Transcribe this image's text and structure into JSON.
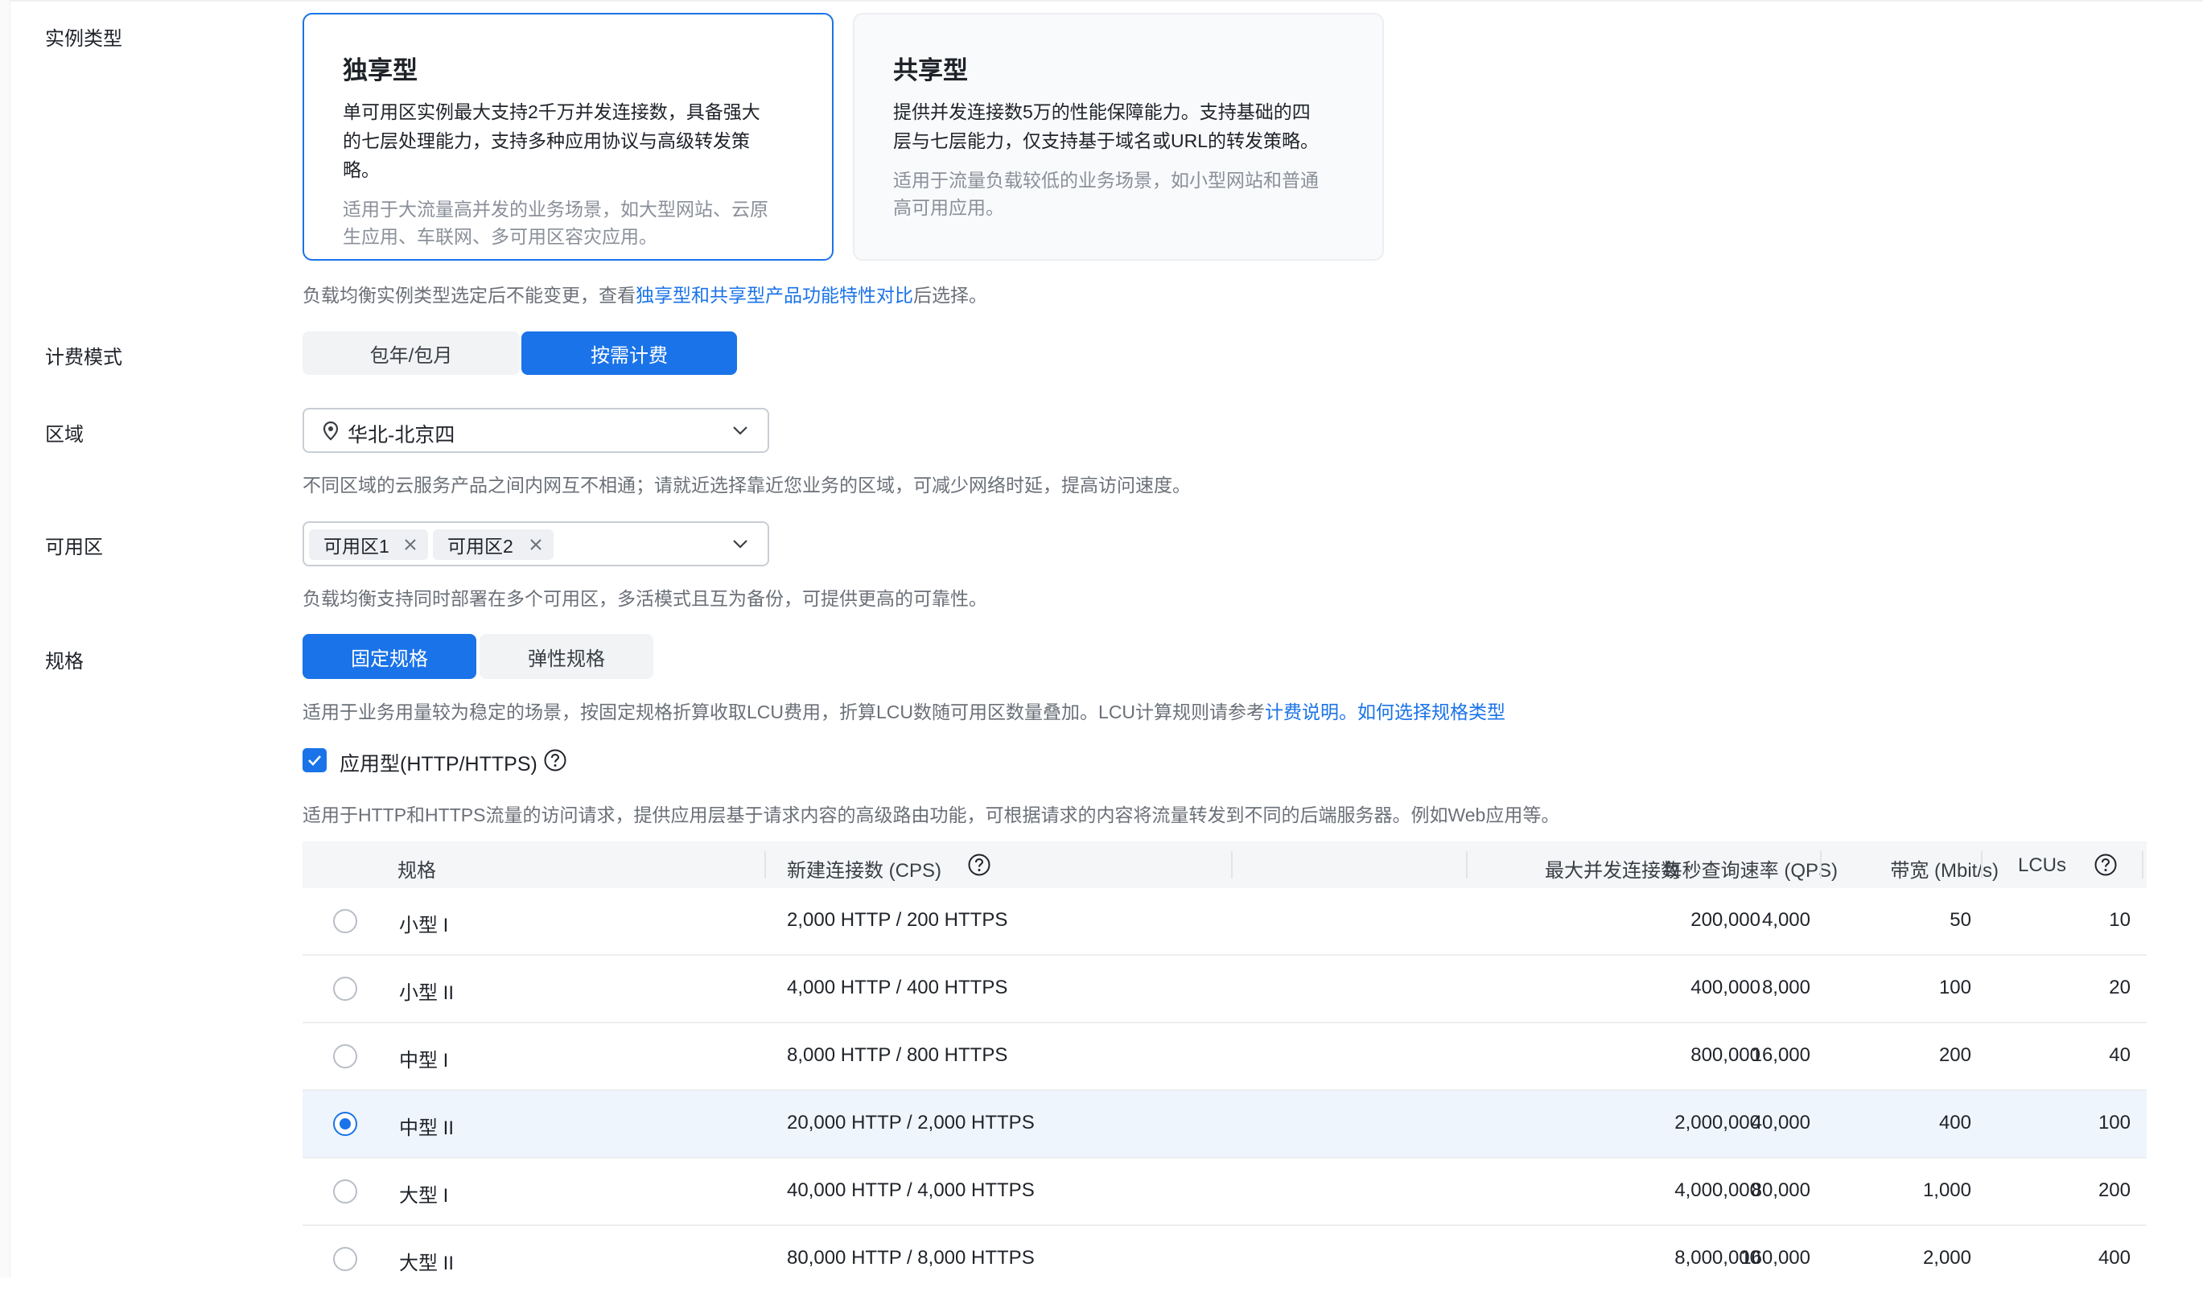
{
  "labels": {
    "instance_type": "实例类型",
    "billing_mode": "计费模式",
    "region": "区域",
    "availability_zone": "可用区",
    "spec": "规格"
  },
  "instance_cards": {
    "dedicated": {
      "title": "独享型",
      "desc_lines": [
        "单可用区实例最大支持2千万并发连接数，具备强大",
        "的七层处理能力，支持多种应用协议与高级转发策",
        "略。"
      ],
      "use_lines": [
        "适用于大流量高并发的业务场景，如大型网站、云原",
        "生应用、车联网、多可用区容灾应用。"
      ]
    },
    "shared": {
      "title": "共享型",
      "desc_lines": [
        "提供并发连接数5万的性能保障能力。支持基础的四",
        "层与七层能力，仅支持基于域名或URL的转发策略。"
      ],
      "use_lines": [
        "适用于流量负载较低的业务场景，如小型网站和普通",
        "高可用应用。"
      ]
    }
  },
  "instance_hint": {
    "prefix": "负载均衡实例类型选定后不能变更，查看",
    "link": "独享型和共享型产品功能特性对比",
    "suffix": "后选择。"
  },
  "billing": {
    "options": [
      "包年/包月",
      "按需计费"
    ],
    "selected": "按需计费"
  },
  "region": {
    "value": "华北-北京四",
    "hint": "不同区域的云服务产品之间内网互不相通；请就近选择靠近您业务的区域，可减少网络时延，提高访问速度。"
  },
  "az": {
    "tags": [
      "可用区1",
      "可用区2"
    ],
    "hint": "负载均衡支持同时部署在多个可用区，多活模式且互为备份，可提供更高的可靠性。"
  },
  "spec": {
    "options": [
      "固定规格",
      "弹性规格"
    ],
    "selected": "固定规格",
    "hint_prefix": "适用于业务用量较为稳定的场景，按固定规格折算收取LCU费用，折算LCU数随可用区数量叠加。LCU计算规则请参考",
    "hint_link1": "计费说明",
    "hint_sep": "。",
    "hint_link2": "如何选择规格类型"
  },
  "app_type": {
    "checked": true,
    "label": "应用型(HTTP/HTTPS)",
    "hint": "适用于HTTP和HTTPS流量的访问请求，提供应用层基于请求内容的高级路由功能，可根据请求的内容将流量转发到不同的后端服务器。例如Web应用等。"
  },
  "table": {
    "headers": {
      "spec": "规格",
      "cps": "新建连接数 (CPS)",
      "max_conn": "最大并发连接数",
      "qps": "每秒查询速率 (QPS)",
      "bandwidth": "带宽 (Mbit/s)",
      "lcus": "LCUs"
    },
    "rows": [
      {
        "spec": "小型 I",
        "cps": "2,000 HTTP / 200 HTTPS",
        "max_conn": "200,000",
        "qps": "4,000",
        "bandwidth": "50",
        "lcus": "10",
        "selected": false
      },
      {
        "spec": "小型 II",
        "cps": "4,000 HTTP / 400 HTTPS",
        "max_conn": "400,000",
        "qps": "8,000",
        "bandwidth": "100",
        "lcus": "20",
        "selected": false
      },
      {
        "spec": "中型 I",
        "cps": "8,000 HTTP / 800 HTTPS",
        "max_conn": "800,000",
        "qps": "16,000",
        "bandwidth": "200",
        "lcus": "40",
        "selected": false
      },
      {
        "spec": "中型 II",
        "cps": "20,000 HTTP / 2,000 HTTPS",
        "max_conn": "2,000,000",
        "qps": "40,000",
        "bandwidth": "400",
        "lcus": "100",
        "selected": true
      },
      {
        "spec": "大型 I",
        "cps": "40,000 HTTP / 4,000 HTTPS",
        "max_conn": "4,000,000",
        "qps": "80,000",
        "bandwidth": "1,000",
        "lcus": "200",
        "selected": false
      },
      {
        "spec": "大型 II",
        "cps": "80,000 HTTP / 8,000 HTTPS",
        "max_conn": "8,000,000",
        "qps": "160,000",
        "bandwidth": "2,000",
        "lcus": "400",
        "selected": false
      }
    ]
  },
  "colors": {
    "accent": "#1a73e8",
    "selected_row": "#eef5fd",
    "hint_text": "#6b7078"
  }
}
